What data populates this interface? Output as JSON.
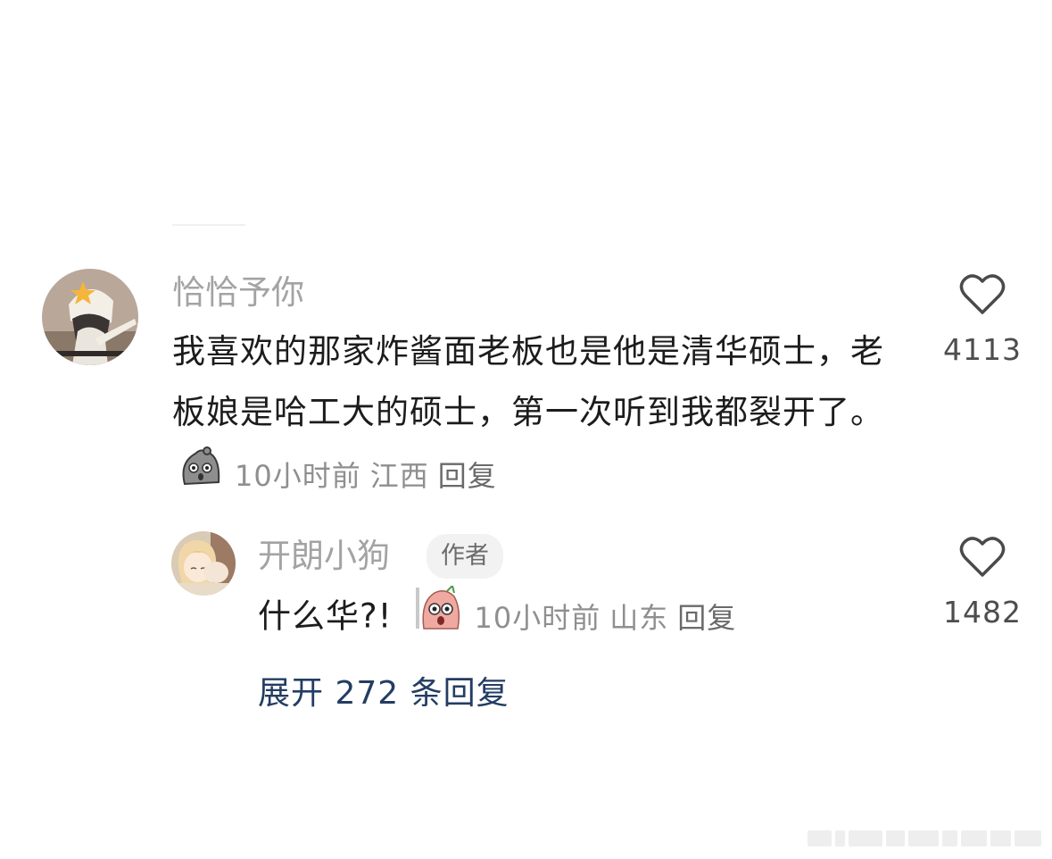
{
  "comment": {
    "username": "恰恰予你",
    "text": "我喜欢的那家炸酱面老板也是他是清华硕士，老板娘是哈工大的硕士，第一次听到我都裂开了。",
    "sticker_icon": "gray-blob-sticker-icon",
    "time": "10小时前",
    "location": "江西",
    "reply_label": "回复",
    "likes": "4113"
  },
  "reply": {
    "username": "开朗小狗",
    "badge": "作者",
    "text": "什么华?!",
    "sticker_icon": "pink-bean-sticker-icon",
    "time": "10小时前",
    "location": "山东",
    "reply_label": "回复",
    "likes": "1482"
  },
  "expand_replies": "展开 272 条回复",
  "icons": {
    "like": "heart-outline-icon"
  },
  "colors": {
    "username": "#a3a3a3",
    "text": "#1c1c1c",
    "link": "#233d63"
  }
}
